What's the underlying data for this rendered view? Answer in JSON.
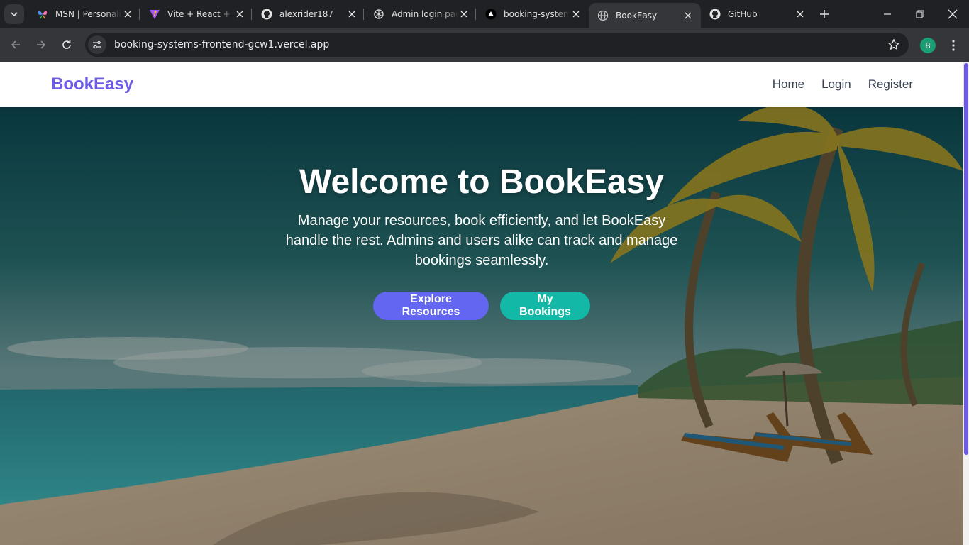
{
  "browser": {
    "tabs": [
      {
        "title": "MSN | Personalized News",
        "favicon": "msn-butterfly-icon",
        "active": false
      },
      {
        "title": "Vite + React + TS",
        "favicon": "vite-icon",
        "active": false
      },
      {
        "title": "alexrider187",
        "favicon": "github-icon",
        "active": false
      },
      {
        "title": "Admin login page",
        "favicon": "openai-icon",
        "active": false
      },
      {
        "title": "booking-systems-frontend",
        "favicon": "vercel-icon",
        "active": false
      },
      {
        "title": "BookEasy",
        "favicon": "globe-icon",
        "active": true
      },
      {
        "title": "GitHub",
        "favicon": "github-icon",
        "active": false
      }
    ],
    "url": "booking-systems-frontend-gcw1.vercel.app",
    "profile_initial": "B"
  },
  "page": {
    "brand": "BookEasy",
    "nav": [
      "Home",
      "Login",
      "Register"
    ],
    "hero": {
      "title": "Welcome to BookEasy",
      "subtitle": "Manage your resources, book efficiently, and let BookEasy handle the rest. Admins and users alike can track and manage bookings seamlessly.",
      "buttons": {
        "explore": "Explore Resources",
        "bookings": "My Bookings"
      }
    }
  },
  "colors": {
    "brand": "#6c5ce7",
    "explore_button": "#6366f1",
    "bookings_button": "#14b8a6"
  }
}
